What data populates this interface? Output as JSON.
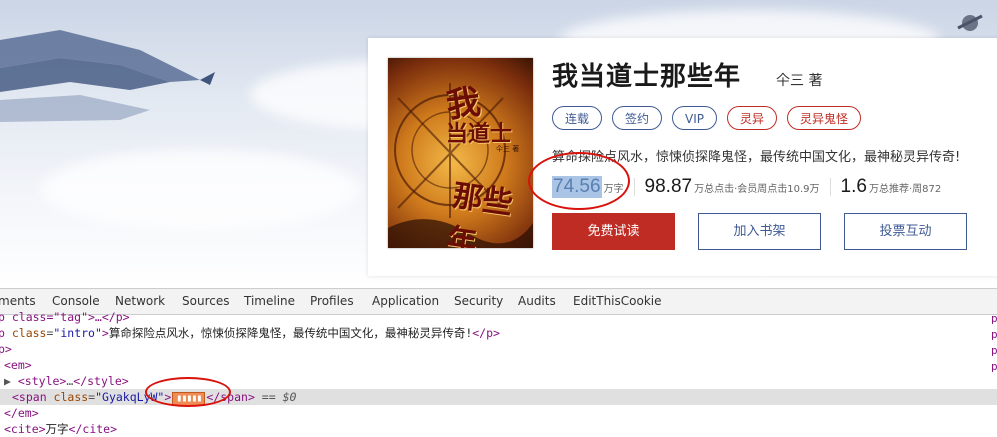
{
  "book": {
    "title": "我当道士那些年",
    "author": "仐三 著",
    "cover_text": [
      "我",
      "当道士",
      "那些年"
    ],
    "cover_author": "仐三 著",
    "tags": [
      {
        "label": "连载",
        "style": "blue"
      },
      {
        "label": "签约",
        "style": "blue"
      },
      {
        "label": "VIP",
        "style": "blue"
      },
      {
        "label": "灵异",
        "style": "red"
      },
      {
        "label": "灵异鬼怪",
        "style": "red"
      }
    ],
    "intro": "算命探险点风水，惊悚侦探降鬼怪，最传统中国文化，最神秘灵异传奇!",
    "stats": [
      {
        "value": "74.56",
        "unit": "万字"
      },
      {
        "value": "98.87",
        "unit": "万总点击·会员周点击10.9万"
      },
      {
        "value": "1.6",
        "unit": "万总推荐·周872"
      }
    ],
    "buttons": {
      "read": "免费试读",
      "shelf": "加入书架",
      "vote": "投票互动"
    }
  },
  "devtools": {
    "tabs": [
      "ments",
      "Console",
      "Network",
      "Sources",
      "Timeline",
      "Profiles",
      "Application",
      "Security",
      "Audits",
      "EditThisCookie"
    ],
    "lines": {
      "l0_pre": "p class=\"tag\">…</p>",
      "l1_p": "p ",
      "l1_attr": "class",
      "l1_val": "\"intro\"",
      "l1_text": "算命探险点风水，惊悚侦探降鬼怪，最传统中国文化，最神秘灵异传奇!",
      "l1_close": "</p>",
      "l2": "p>",
      "l3": "<em>",
      "l4_open": "<style>",
      "l4_ell": "…",
      "l4_close": "</style>",
      "l5_open": "<span ",
      "l5_attr": "class",
      "l5_val": "\"GyakqLyW\"",
      "l5_obf": "▮▮▮▮▮",
      "l5_close": "</span>",
      "l5_eq": " == $0",
      "l6": "</em>",
      "l7_open": "<cite>",
      "l7_text": "万字",
      "l7_close": "</cite>"
    },
    "right_edge": [
      "p",
      "p",
      "p",
      "p"
    ]
  },
  "colors": {
    "primary_red": "#bf2c24",
    "outline_blue": "#3f5a93",
    "highlight_blue": "#a9c4e4",
    "annotation_red": "#d9120b"
  }
}
